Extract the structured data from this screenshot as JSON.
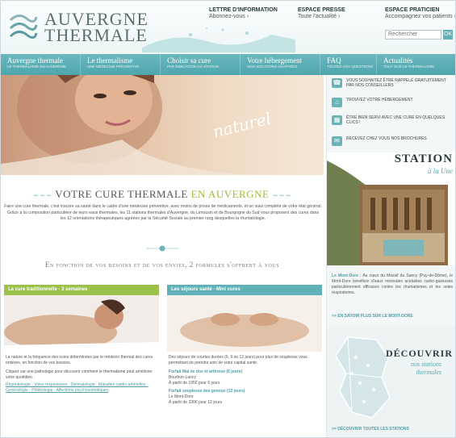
{
  "header": {
    "brand_line1": "AUVERGNE",
    "brand_line2": "THERMALE",
    "columns": [
      {
        "title": "LETTRE D'INFORMATION",
        "sub": "Abonnez-vous ›"
      },
      {
        "title": "ESPACE PRESSE",
        "sub": "Toute l'actualité ›"
      },
      {
        "title": "ESPACE PRATICIEN",
        "sub": "Accompagnez vos patients ›"
      }
    ],
    "search_placeholder": "Rechercher",
    "search_button": "OK"
  },
  "nav": [
    {
      "label": "Auvergne thermale",
      "sub": "Le thermalisme en Auvergne"
    },
    {
      "label": "Le thermalisme",
      "sub": "Une médecine préventive"
    },
    {
      "label": "Choisir sa cure",
      "sub": "Par indication ou station"
    },
    {
      "label": "Votre hébergement",
      "sub": "Nos solutions adaptées"
    },
    {
      "label": "FAQ",
      "sub": "Toutes vos questions"
    },
    {
      "label": "Actualités",
      "sub": "Tout sur le thermalisme"
    }
  ],
  "hero": {
    "tagline": "naturel"
  },
  "sidebar": {
    "links": [
      {
        "text": "Vous souhaitez ÊTRE RAPPELÉ gratuitement par nos conseillers"
      },
      {
        "text": "Trouvez votre HÉBERGEMENT"
      },
      {
        "text": "Être bien SERVI avec une cure en quelques clics !"
      },
      {
        "text": "Recevez chez vous nos BROCHURES"
      }
    ],
    "station_title": "STATION",
    "station_sub": "à la Une",
    "station_name": "Le Mont-Dore",
    "station_text": " : Au cœur du Massif du Sancy (Puy-de-Dôme), le Mont-Dore bénéficie d'eaux minérales acidulées carbo-gazeuses particulièrement efficaces contre les rhumatismes et les voies respiratoires.",
    "more_link": ">> En savoir plus sur le Mont-Dore",
    "discover_title": "DÉCOUVRIR",
    "discover_sub1": "nos stations",
    "discover_sub2": "thermales",
    "discover_all": ">> Découvrir toutes les stations"
  },
  "main": {
    "title_pre": "VOTRE CURE THERMALE",
    "title_hl": "EN AUVERGNE",
    "intro": "Faire une cure thermale, c'est inscrire sa santé dans le cadre d'une médecine préventive, avec moins de prises de médicaments, et un suivi complété de votre état général. Grâce à la composition particulière de leurs eaux thermales, les 11 stations thermales d'Auvergne, du Limousin et de Bourgogne du Sud vous proposent des cures dans les 12 orientations thérapeutiques agréées par la Sécurité Sociale au premier rang desquelles la rhumatologie.",
    "formula": "En fonction de vos besoins et de vos envies, 2 formules s'offrent à vous"
  },
  "box_cure": {
    "header": "La cure traditionnelle - 3 semaines",
    "text1": "La nature et la fréquence des soins déterminées par le médecin thermal des cures entières, en fonction de vos besoins.",
    "text2": "Cliquez sur une pathologie pour découvrir comment le thermalisme peut améliorer votre quotidien :",
    "links": "Rhumatologie · Voies respiratoires · Dermatologie · Maladies cardio-artérielles · Gynécologie · Phlébologie · Affections psychosomatiques"
  },
  "box_sejour": {
    "header": "Les séjours santé - Mini cures",
    "text": "Des séjours de courtes durées (6, 9 ou 12 jours) pour plus de souplesse vous permettant de prendre soin de votre capital santé.",
    "offers": [
      {
        "title": "Forfait Mal de dos et arthrose (6 jours)",
        "place": "Bourbon-Lancy",
        "price": "À partir de 195€ pour 6 jours"
      },
      {
        "title": "Forfait souplesse des genoux (12 jours)",
        "place": "Le Mont-Dore",
        "price": "À partir de 330€ pour 12 jours"
      }
    ]
  }
}
